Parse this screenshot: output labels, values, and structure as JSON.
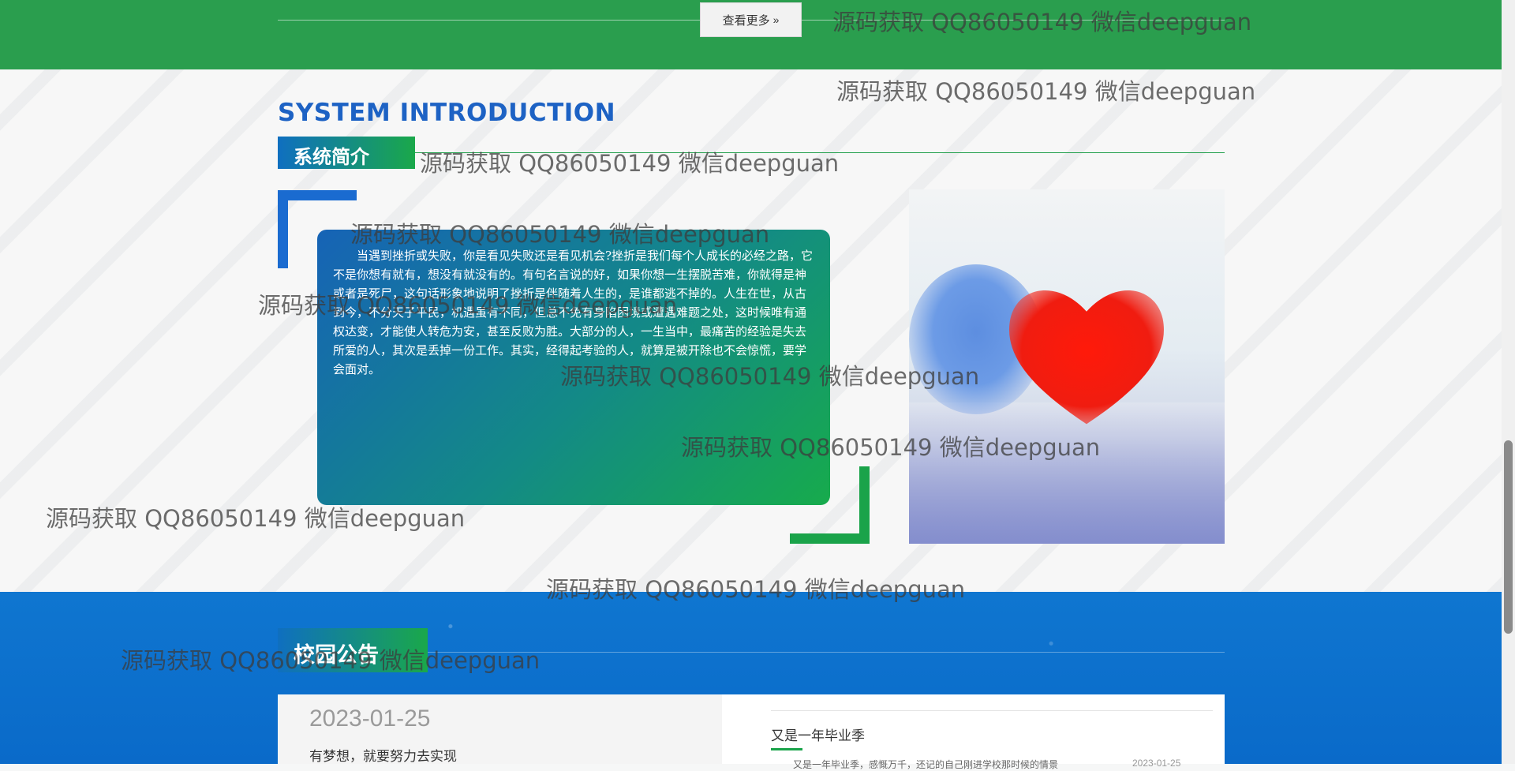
{
  "top": {
    "more_button": "查看更多",
    "more_icon": "double-chevron-right-icon"
  },
  "intro": {
    "title_en": "SYSTEM INTRODUCTION",
    "title_cn": "系统简介",
    "paragraph": "当遇到挫折或失败，你是看见失败还是看见机会?挫折是我们每个人成长的必经之路，它不是你想有就有，想没有就没有的。有句名言说的好，如果你想一生摆脱苦难，你就得是神或者是死尸，这句话形象地说明了挫折是伴随着人生的，是谁都逃不掉的。人生在世，从古到今，不分天子平民，机遇虽有不同，但总不免有身陷困境或遭遇难题之处，这时候唯有通权达变，才能使人转危为安，甚至反败为胜。大部分的人，一生当中，最痛苦的经验是失去所爱的人，其次是丢掉一份工作。其实，经得起考验的人，就算是被开除也不会惊慌，要学会面对。"
  },
  "notices": {
    "section_title": "校园公告",
    "featured": {
      "date": "2023-01-25",
      "headline": "有梦想，就要努力去实现"
    },
    "list": [
      {
        "title": "又是一年毕业季",
        "snippet": "又是一年毕业季，感慨万千，还记的自己刚进学校那时候的情景",
        "date": "2023-01-25"
      }
    ]
  },
  "watermark": "源码获取 QQ86050149 微信deepguan",
  "colors": {
    "green": "#2a9e4e",
    "blue": "#1a6bd0",
    "notice_blue": "#0f76d0"
  }
}
